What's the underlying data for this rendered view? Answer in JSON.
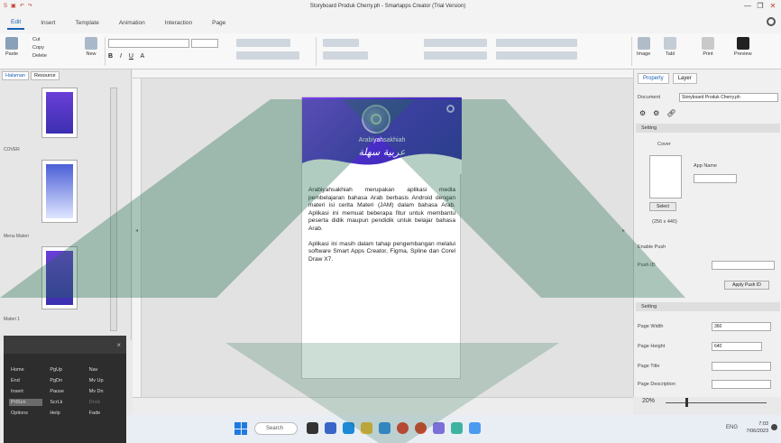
{
  "window": {
    "title": "Storyboard Produk Cherry.ph - Smartapps Creator (Trial Version)",
    "controls": [
      "—",
      "❐",
      "✕"
    ]
  },
  "ribbon_tabs": [
    "Edit",
    "Insert",
    "Template",
    "Animation",
    "Interaction",
    "Page"
  ],
  "ribbon": {
    "paste_label": "Paste",
    "cut_label": "Cut",
    "copy_label": "Copy",
    "delete_label": "Delete",
    "new_label": "New",
    "image_label": "Image",
    "tabl_label": "Tabl",
    "print_label": "Print",
    "preview_label": "Preview"
  },
  "left_pane": {
    "tabs": [
      "Halaman",
      "Resource"
    ],
    "sections": [
      "COVER",
      "Menu Materi",
      "Materi 1"
    ]
  },
  "float_panel": {
    "close": "×",
    "keys": [
      "Home",
      "PgUp",
      "Nav",
      "End",
      "PgDn",
      "Mv Up",
      "Insert",
      "Pause",
      "Mv Dn",
      "PrtScn",
      "ScrLk",
      "Dock",
      "Options",
      "Help",
      "Fade"
    ]
  },
  "page": {
    "app_name": "Arabiyahsakhiah",
    "arabic_title": "ﻋﺮﺑﻴﺔ ﺳﻬﻠﺔ",
    "paragraph1": "Arabiyahsakhiah merupakan aplikasi media pembelajaran bahasa Arab berbasis Android dengan materi isi cerita Materi (JAM) dalam bahasa Arab. Aplikasi ini memuat beberapa fitur untuk membantu peserta didik maupun pendidik untuk belajar bahasa Arab.",
    "paragraph2": "Aplikasi ini masih dalam tahap pengembangan melalui software Smart Apps Creator, Figma, Spline dan Corel Draw X7."
  },
  "right_pane": {
    "tabs": [
      "Property",
      "Layer"
    ],
    "document_label": "Document",
    "document_value": "Storyboard Produk Cherry.ph",
    "setting_label": "Setting",
    "cover_label": "Cover",
    "app_name_label": "App Name",
    "select_label": "Select",
    "cover_size": "(256 x 440)",
    "enable_push_label": "Enable Push",
    "push_id_label": "Push ID",
    "apply_push_label": "Apply Push ID",
    "page_setting_label": "Setting",
    "page_width_label": "Page Width",
    "page_width_value": "360",
    "page_height_label": "Page Height",
    "page_height_value": "640",
    "page_title_label": "Page Title",
    "page_description_label": "Page Description",
    "zoom": "20%"
  },
  "taskbar": {
    "search": "Search",
    "tray": "ENG",
    "time": "7:03",
    "date": "7/06/2023"
  }
}
